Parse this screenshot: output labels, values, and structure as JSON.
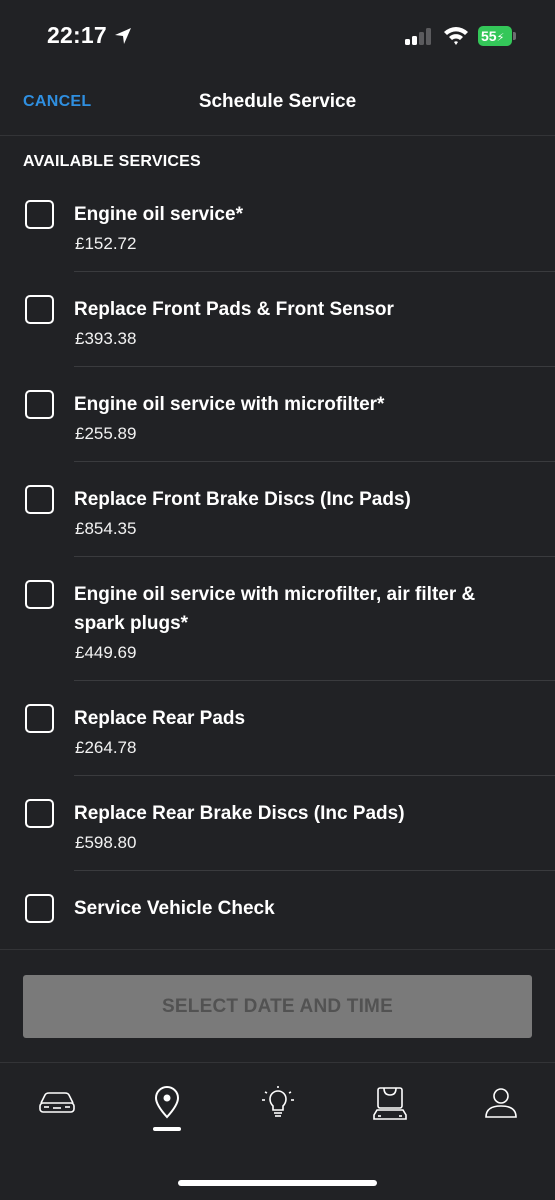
{
  "status_bar": {
    "time": "22:17",
    "battery": "55"
  },
  "header": {
    "cancel_label": "CANCEL",
    "title": "Schedule Service"
  },
  "section_header": "AVAILABLE SERVICES",
  "services": [
    {
      "name": "Engine oil service*",
      "price": "£152.72"
    },
    {
      "name": "Replace Front Pads & Front Sensor",
      "price": "£393.38"
    },
    {
      "name": "Engine oil service with microfilter*",
      "price": "£255.89"
    },
    {
      "name": "Replace Front Brake Discs (Inc Pads)",
      "price": "£854.35"
    },
    {
      "name": "Engine oil service with microfilter, air filter & spark plugs*",
      "price": "£449.69"
    },
    {
      "name": "Replace Rear Pads",
      "price": "£264.78"
    },
    {
      "name": "Replace Rear Brake Discs (Inc Pads)",
      "price": "£598.80"
    },
    {
      "name": "Service Vehicle Check",
      "price": ""
    }
  ],
  "footer": {
    "select_button_label": "SELECT DATE AND TIME"
  },
  "tab_bar": {
    "tabs": [
      {
        "icon": "car-icon",
        "active": false
      },
      {
        "icon": "location-pin-icon",
        "active": true
      },
      {
        "icon": "lightbulb-icon",
        "active": false
      },
      {
        "icon": "vehicle-shop-icon",
        "active": false
      },
      {
        "icon": "profile-icon",
        "active": false
      }
    ]
  },
  "colors": {
    "background": "#212225",
    "accent": "#2f8fe0",
    "battery": "#34c759",
    "button_disabled": "#7a7a7a"
  }
}
